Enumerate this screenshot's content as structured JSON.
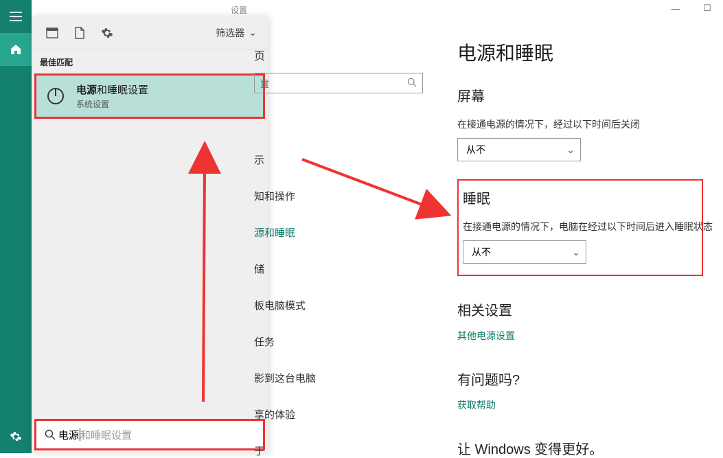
{
  "window": {
    "title": "设置"
  },
  "rail": {
    "hamburger": "≡",
    "home": "⌂",
    "settings": "⚙"
  },
  "start_panel": {
    "filter_label": "筛选器",
    "best_match_label": "最佳匹配",
    "result": {
      "title_bold": "电源",
      "title_rest": "和睡眠设置",
      "subtitle": "系统设置"
    },
    "search": {
      "typed": "电源",
      "placeholder_rest": "和睡眠设置"
    }
  },
  "settings": {
    "home_label": "页",
    "search_placeholder": "置",
    "side_items": [
      "示",
      "知和操作",
      "源和睡眠",
      "储",
      "板电脑模式",
      "任务",
      "影到这台电脑",
      "享的体验",
      "于"
    ],
    "side_selected_index": 2
  },
  "content": {
    "page_title": "电源和睡眠",
    "section_screen": {
      "title": "屏幕",
      "desc": "在接通电源的情况下，经过以下时间后关闭",
      "value": "从不"
    },
    "section_sleep": {
      "title": "睡眠",
      "desc": "在接通电源的情况下，电脑在经过以下时间后进入睡眠状态",
      "value": "从不"
    },
    "related_title": "相关设置",
    "related_link": "其他电源设置",
    "help_title": "有问题吗?",
    "help_link": "获取帮助",
    "better_title": "让 Windows 变得更好。"
  }
}
